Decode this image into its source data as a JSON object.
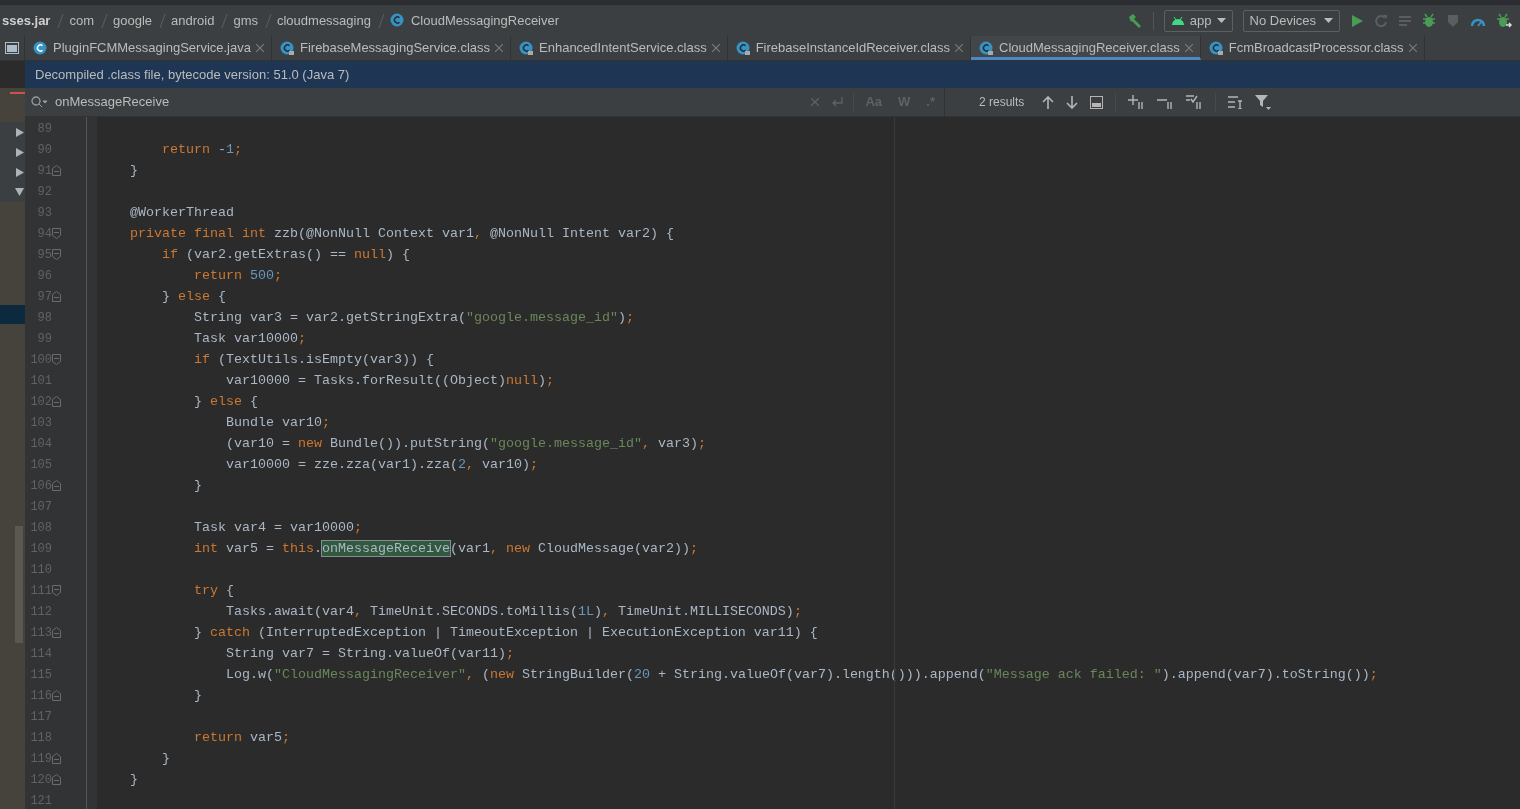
{
  "breadcrumb": [
    {
      "text": "sses.jar",
      "kind": "jar"
    },
    {
      "text": "com",
      "kind": "package"
    },
    {
      "text": "google",
      "kind": "package"
    },
    {
      "text": "android",
      "kind": "package"
    },
    {
      "text": "gms",
      "kind": "package"
    },
    {
      "text": "cloudmessaging",
      "kind": "package"
    },
    {
      "text": "CloudMessagingReceiver",
      "kind": "class"
    }
  ],
  "toolbar": {
    "config": "app",
    "device": "No Devices"
  },
  "tabs": [
    {
      "label": "PluginFCMMessagingService.java",
      "kind": "java",
      "selected": false
    },
    {
      "label": "FirebaseMessagingService.class",
      "kind": "class",
      "selected": false
    },
    {
      "label": "EnhancedIntentService.class",
      "kind": "class",
      "selected": false
    },
    {
      "label": "FirebaseInstanceIdReceiver.class",
      "kind": "class",
      "selected": false
    },
    {
      "label": "CloudMessagingReceiver.class",
      "kind": "class",
      "selected": true
    },
    {
      "label": "FcmBroadcastProcessor.class",
      "kind": "class",
      "selected": false
    }
  ],
  "banner": "Decompiled .class file, bytecode version: 51.0 (Java 7)",
  "find": {
    "value": "onMessageReceive",
    "options": [
      {
        "label": "Aa",
        "selected": false
      },
      {
        "label": "W",
        "selected": false
      },
      {
        "label": ".*",
        "selected": false
      }
    ],
    "results": "2 results"
  },
  "project_tree": [
    {
      "expanded": false
    },
    {
      "expanded": false
    },
    {
      "expanded": false
    },
    {
      "expanded": true
    }
  ],
  "code": [
    {
      "number": "89",
      "kind": "plain"
    },
    {
      "number": "90",
      "kind": "plain",
      "segments": [
        {
          "kind": "keyword",
          "text": "        return"
        },
        {
          "kind": "plain",
          "text": " -"
        },
        {
          "kind": "number",
          "text": "1"
        },
        {
          "kind": "plain",
          "text": ";"
        }
      ]
    },
    {
      "number": "91",
      "kind": "fold_end",
      "segments": [
        {
          "kind": "plain",
          "text": "    }"
        }
      ]
    },
    {
      "number": "92",
      "kind": "plain"
    },
    {
      "number": "93",
      "kind": "plain",
      "segments": [
        {
          "kind": "plain",
          "text": "    @WorkerThread"
        }
      ]
    },
    {
      "number": "94",
      "kind": "fold_start",
      "segments": [
        {
          "kind": "keyword",
          "text": "    private final int"
        },
        {
          "kind": "plain",
          "text": " zzb(@NonNull Context var1, @NonNull Intent var2) {"
        }
      ]
    },
    {
      "number": "95",
      "kind": "fold_start",
      "segments": [
        {
          "kind": "keyword",
          "text": "        if"
        },
        {
          "kind": "plain",
          "text": " (var2.getExtras() == "
        },
        {
          "kind": "keyword",
          "text": "null"
        },
        {
          "kind": "plain",
          "text": ") {"
        }
      ]
    },
    {
      "number": "96",
      "kind": "plain",
      "segments": [
        {
          "kind": "keyword",
          "text": "            return"
        },
        {
          "kind": "number",
          "text": " 500"
        },
        {
          "kind": "plain",
          "text": ";"
        }
      ]
    },
    {
      "number": "97",
      "kind": "fold_end",
      "segments": [
        {
          "kind": "plain",
          "text": "        } "
        },
        {
          "kind": "keyword",
          "text": "else"
        },
        {
          "kind": "plain",
          "text": " {"
        }
      ]
    },
    {
      "number": "98",
      "kind": "plain",
      "segments": [
        {
          "kind": "plain",
          "text": "            String var3 = var2.getStringExtra("
        },
        {
          "kind": "string",
          "text": "\"google.message_id\""
        },
        {
          "kind": "plain",
          "text": ");"
        }
      ]
    },
    {
      "number": "99",
      "kind": "plain",
      "segments": [
        {
          "kind": "plain",
          "text": "            Task var10000;"
        }
      ]
    },
    {
      "number": "100",
      "kind": "fold_start",
      "segments": [
        {
          "kind": "keyword",
          "text": "            if"
        },
        {
          "kind": "plain",
          "text": " (TextUtils.isEmpty(var3)) {"
        }
      ]
    },
    {
      "number": "101",
      "kind": "plain",
      "segments": [
        {
          "kind": "plain",
          "text": "                var10000 = Tasks.forResult((Object)"
        },
        {
          "kind": "keyword",
          "text": "null"
        },
        {
          "kind": "plain",
          "text": ");"
        }
      ]
    },
    {
      "number": "102",
      "kind": "fold_end",
      "segments": [
        {
          "kind": "plain",
          "text": "            } "
        },
        {
          "kind": "keyword",
          "text": "else"
        },
        {
          "kind": "plain",
          "text": " {"
        }
      ]
    },
    {
      "number": "103",
      "kind": "plain",
      "segments": [
        {
          "kind": "plain",
          "text": "                Bundle var10;"
        }
      ]
    },
    {
      "number": "104",
      "kind": "plain",
      "segments": [
        {
          "kind": "plain",
          "text": "                (var10 = "
        },
        {
          "kind": "keyword",
          "text": "new"
        },
        {
          "kind": "plain",
          "text": " Bundle()).putString("
        },
        {
          "kind": "string",
          "text": "\"google.message_id\""
        },
        {
          "kind": "plain",
          "text": ", var3);"
        }
      ]
    },
    {
      "number": "105",
      "kind": "plain",
      "segments": [
        {
          "kind": "plain",
          "text": "                var10000 = zze.zza(var1).zza("
        },
        {
          "kind": "number",
          "text": "2"
        },
        {
          "kind": "plain",
          "text": ", var10);"
        }
      ]
    },
    {
      "number": "106",
      "kind": "fold_end",
      "segments": [
        {
          "kind": "plain",
          "text": "            }"
        }
      ]
    },
    {
      "number": "107",
      "kind": "plain"
    },
    {
      "number": "108",
      "kind": "plain",
      "segments": [
        {
          "kind": "plain",
          "text": "            Task var4 = var10000;"
        }
      ]
    },
    {
      "number": "109",
      "kind": "plain",
      "segments": [
        {
          "kind": "keyword",
          "text": "            int"
        },
        {
          "kind": "plain",
          "text": " var5 = "
        },
        {
          "kind": "keyword",
          "text": "this"
        },
        {
          "kind": "plain",
          "text": "."
        },
        {
          "kind": "match",
          "text": "onMessageReceive"
        },
        {
          "kind": "plain",
          "text": "(var1, "
        },
        {
          "kind": "keyword",
          "text": "new"
        },
        {
          "kind": "plain",
          "text": " CloudMessage(var2));"
        }
      ]
    },
    {
      "number": "110",
      "kind": "plain"
    },
    {
      "number": "111",
      "kind": "fold_start",
      "segments": [
        {
          "kind": "keyword",
          "text": "            try"
        },
        {
          "kind": "plain",
          "text": " {"
        }
      ]
    },
    {
      "number": "112",
      "kind": "plain",
      "segments": [
        {
          "kind": "plain",
          "text": "                Tasks.await(var4, TimeUnit.SECONDS.toMillis("
        },
        {
          "kind": "number",
          "text": "1L"
        },
        {
          "kind": "plain",
          "text": "), TimeUnit.MILLISECONDS);"
        }
      ]
    },
    {
      "number": "113",
      "kind": "fold_end",
      "segments": [
        {
          "kind": "plain",
          "text": "            } "
        },
        {
          "kind": "keyword",
          "text": "catch"
        },
        {
          "kind": "plain",
          "text": " (InterruptedException | TimeoutException | ExecutionException var11) {"
        }
      ]
    },
    {
      "number": "114",
      "kind": "plain",
      "segments": [
        {
          "kind": "plain",
          "text": "                String var7 = String.valueOf(var11);"
        }
      ]
    },
    {
      "number": "115",
      "kind": "plain",
      "segments": [
        {
          "kind": "plain",
          "text": "                Log.w("
        },
        {
          "kind": "string",
          "text": "\"CloudMessagingReceiver\""
        },
        {
          "kind": "plain",
          "text": ", ("
        },
        {
          "kind": "keyword",
          "text": "new"
        },
        {
          "kind": "plain",
          "text": " StringBuilder("
        },
        {
          "kind": "number",
          "text": "20"
        },
        {
          "kind": "plain",
          "text": " + String.valueOf(var7).length())).append("
        },
        {
          "kind": "string",
          "text": "\"Message ack failed: \""
        },
        {
          "kind": "plain",
          "text": ").append(var7).toString());"
        }
      ]
    },
    {
      "number": "116",
      "kind": "fold_end",
      "segments": [
        {
          "kind": "plain",
          "text": "            }"
        }
      ]
    },
    {
      "number": "117",
      "kind": "plain"
    },
    {
      "number": "118",
      "kind": "plain",
      "segments": [
        {
          "kind": "keyword",
          "text": "            return"
        },
        {
          "kind": "plain",
          "text": " var5;"
        }
      ]
    },
    {
      "number": "119",
      "kind": "fold_end",
      "segments": [
        {
          "kind": "plain",
          "text": "        }"
        }
      ]
    },
    {
      "number": "120",
      "kind": "fold_end",
      "segments": [
        {
          "kind": "plain",
          "text": "    }"
        }
      ]
    },
    {
      "number": "121",
      "kind": "plain"
    }
  ]
}
